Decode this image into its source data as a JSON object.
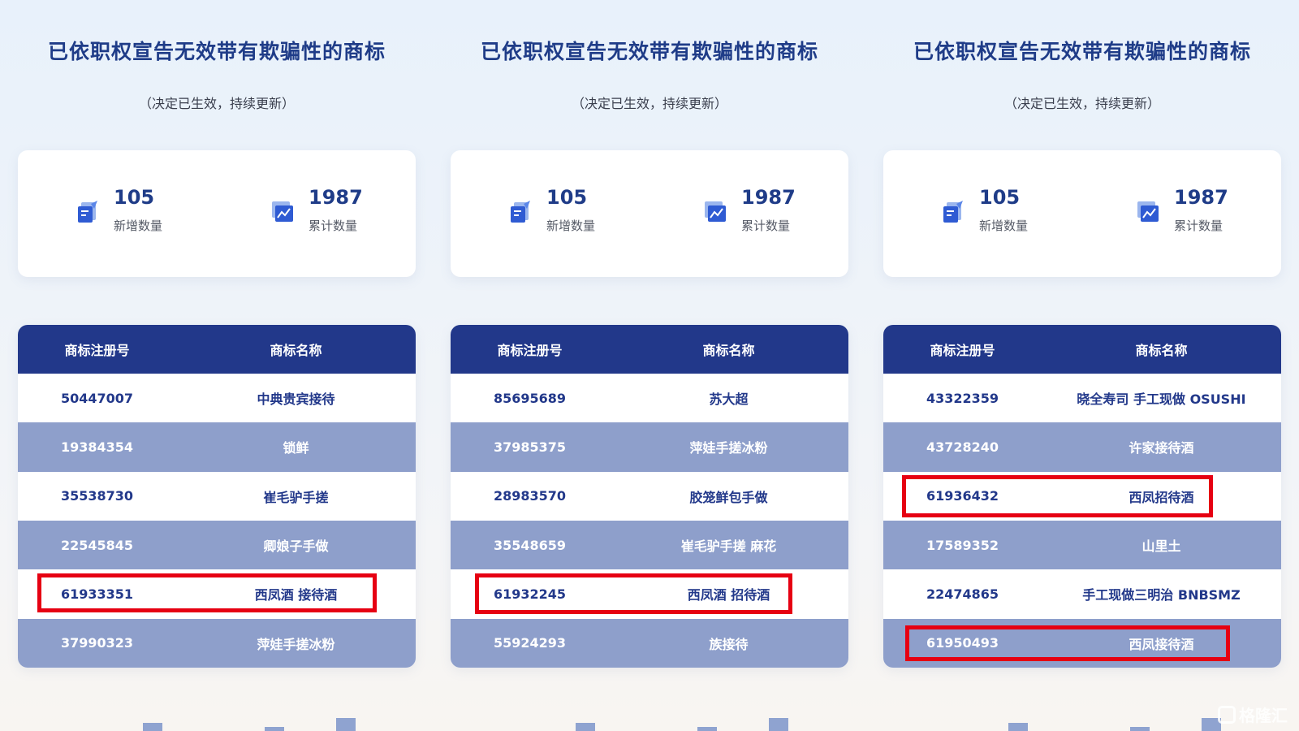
{
  "colors": {
    "title": "#1f3c88",
    "header_bg": "#22388a",
    "row_alt_bg": "#8e9fcb",
    "highlight": "#e60012"
  },
  "panels": [
    {
      "title": "已依职权宣告无效带有欺骗性的商标",
      "subtitle": "（决定已生效，持续更新）",
      "stats": {
        "new": {
          "value": "105",
          "label": "新增数量",
          "icon": "document-add-icon"
        },
        "total": {
          "value": "1987",
          "label": "累计数量",
          "icon": "chart-image-icon"
        }
      },
      "table": {
        "headers": [
          "商标注册号",
          "商标名称"
        ],
        "rows": [
          {
            "reg_no": "50447007",
            "name": "中典贵宾接待",
            "highlighted": false
          },
          {
            "reg_no": "19384354",
            "name": "锁鲜",
            "highlighted": false
          },
          {
            "reg_no": "35538730",
            "name": "崔毛驴手搓",
            "highlighted": false
          },
          {
            "reg_no": "22545845",
            "name": "卿娘子手做",
            "highlighted": false
          },
          {
            "reg_no": "61933351",
            "name": "西凤酒 接待酒",
            "highlighted": true
          },
          {
            "reg_no": "37990323",
            "name": "萍娃手搓冰粉",
            "highlighted": false
          }
        ]
      }
    },
    {
      "title": "已依职权宣告无效带有欺骗性的商标",
      "subtitle": "（决定已生效，持续更新）",
      "stats": {
        "new": {
          "value": "105",
          "label": "新增数量",
          "icon": "document-add-icon"
        },
        "total": {
          "value": "1987",
          "label": "累计数量",
          "icon": "chart-image-icon"
        }
      },
      "table": {
        "headers": [
          "商标注册号",
          "商标名称"
        ],
        "rows": [
          {
            "reg_no": "85695689",
            "name": "苏大超",
            "highlighted": false
          },
          {
            "reg_no": "37985375",
            "name": "萍娃手搓冰粉",
            "highlighted": false
          },
          {
            "reg_no": "28983570",
            "name": "胶笼鲜包手做",
            "highlighted": false
          },
          {
            "reg_no": "35548659",
            "name": "崔毛驴手搓 麻花",
            "highlighted": false
          },
          {
            "reg_no": "61932245",
            "name": "西凤酒 招待酒",
            "highlighted": true
          },
          {
            "reg_no": "55924293",
            "name": "族接待",
            "highlighted": false
          }
        ]
      }
    },
    {
      "title": "已依职权宣告无效带有欺骗性的商标",
      "subtitle": "（决定已生效，持续更新）",
      "stats": {
        "new": {
          "value": "105",
          "label": "新增数量",
          "icon": "document-add-icon"
        },
        "total": {
          "value": "1987",
          "label": "累计数量",
          "icon": "chart-image-icon"
        }
      },
      "table": {
        "headers": [
          "商标注册号",
          "商标名称"
        ],
        "rows": [
          {
            "reg_no": "43322359",
            "name": "晓全寿司 手工现做 OSUSHI",
            "highlighted": false
          },
          {
            "reg_no": "43728240",
            "name": "许家接待酒",
            "highlighted": false
          },
          {
            "reg_no": "61936432",
            "name": "西凤招待酒",
            "highlighted": true
          },
          {
            "reg_no": "17589352",
            "name": "山里土",
            "highlighted": false
          },
          {
            "reg_no": "22474865",
            "name": "手工现做三明治 BNBSMZ",
            "highlighted": false
          },
          {
            "reg_no": "61950493",
            "name": "西凤接待酒",
            "highlighted": true
          }
        ]
      }
    }
  ],
  "watermark": {
    "text": "格隆汇",
    "icon": "gelonghui-logo-icon"
  }
}
